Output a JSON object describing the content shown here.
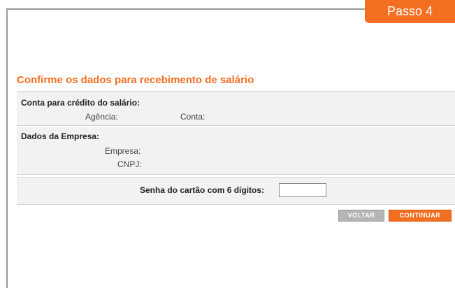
{
  "step": {
    "label": "Passo 4"
  },
  "form": {
    "title": "Confirme os dados para recebimento de salário",
    "account": {
      "heading": "Conta para crédito do salário:",
      "agency_label": "Agência:",
      "account_label": "Conta:"
    },
    "company": {
      "heading": "Dados da Empresa:",
      "company_label": "Empresa:",
      "cnpj_label": "CNPJ:"
    },
    "password": {
      "label": "Senha do cartão com 6 dígitos:",
      "value": ""
    }
  },
  "actions": {
    "back_label": "VOLTAR",
    "continue_label": "CONTINUAR"
  },
  "colors": {
    "accent": "#f26f21",
    "panel_bg": "#f2f2f2",
    "back_button": "#b5b5b5"
  }
}
